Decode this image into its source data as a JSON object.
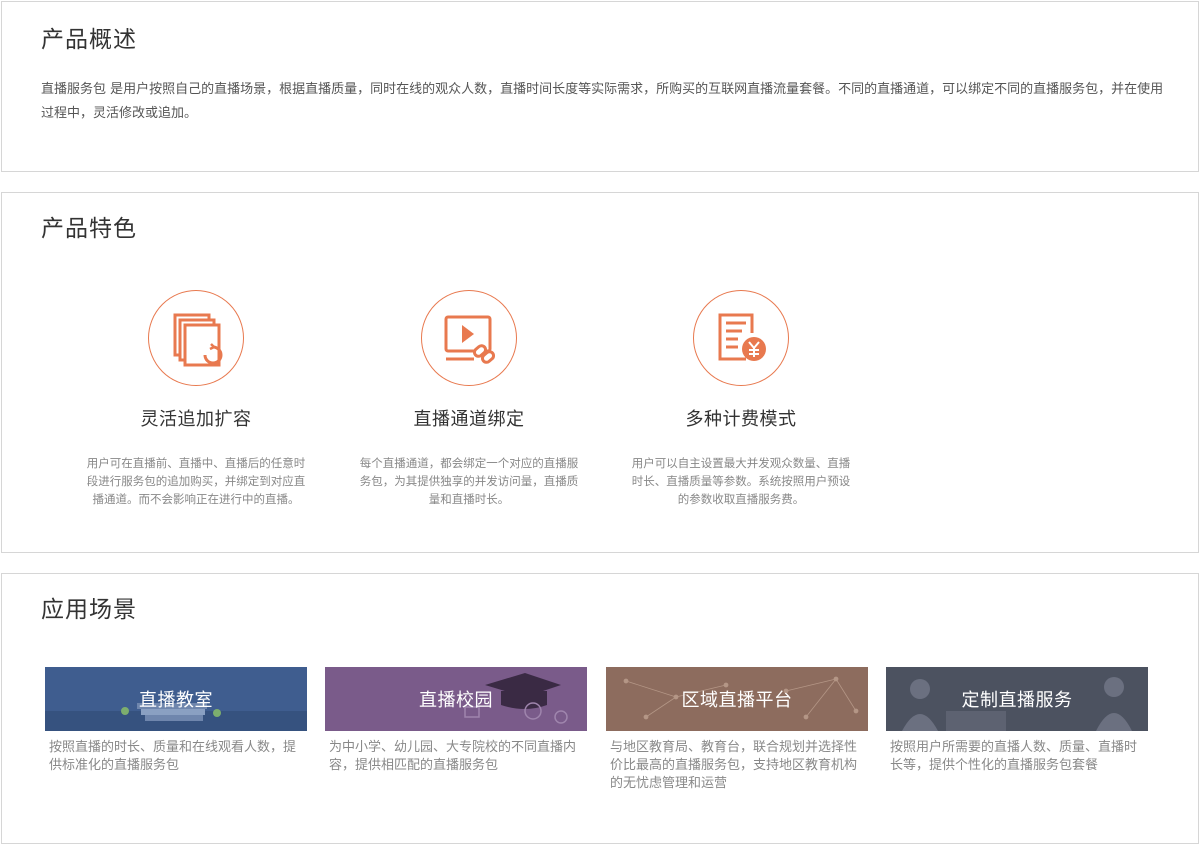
{
  "overview": {
    "title": "产品概述",
    "text": "直播服务包 是用户按照自己的直播场景，根据直播质量，同时在线的观众人数，直播时间长度等实际需求，所购买的互联网直播流量套餐。不同的直播通道，可以绑定不同的直播服务包，并在使用过程中，灵活修改或追加。"
  },
  "features": {
    "title": "产品特色",
    "accent_color": "#e8794f",
    "items": [
      {
        "icon": "documents-refresh-icon",
        "title": "灵活追加扩容",
        "desc": "用户可在直播前、直播中、直播后的任意时段进行服务包的追加购买，并绑定到对应直播通道。而不会影响正在进行中的直播。"
      },
      {
        "icon": "video-link-icon",
        "title": "直播通道绑定",
        "desc": "每个直播通道，都会绑定一个对应的直播服务包，为其提供独享的并发访问量，直播质量和直播时长。"
      },
      {
        "icon": "bill-yen-icon",
        "title": "多种计费模式",
        "desc": "用户可以自主设置最大并发观众数量、直播时长、直播质量等参数。系统按照用户预设的参数收取直播服务费。"
      }
    ]
  },
  "scenarios": {
    "title": "应用场景",
    "items": [
      {
        "name": "直播教室",
        "desc": "按照直播的时长、质量和在线观看人数，提供标准化的直播服务包",
        "color": "#3f5d8f"
      },
      {
        "name": "直播校园",
        "desc": "为中小学、幼儿园、大专院校的不同直播内容，提供相匹配的直播服务包",
        "color": "#7a5b8a"
      },
      {
        "name": "区域直播平台",
        "desc": "与地区教育局、教育台，联合规划并选择性价比最高的直播服务包，支持地区教育机构的无忧虑管理和运营",
        "color": "#8d6c5e"
      },
      {
        "name": "定制直播服务",
        "desc": "按照用户所需要的直播人数、质量、直播时长等，提供个性化的直播服务包套餐",
        "color": "#4c5260"
      }
    ]
  }
}
